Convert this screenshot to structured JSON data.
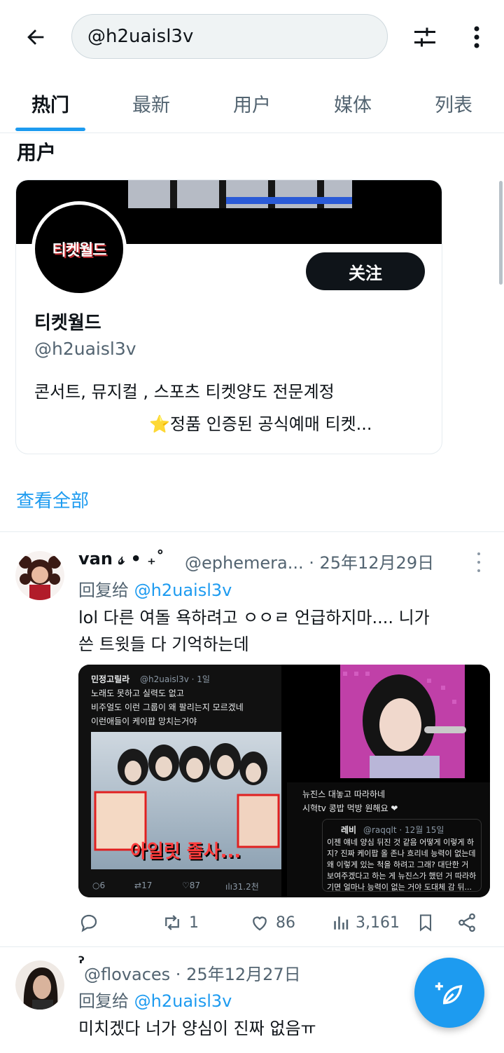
{
  "search": {
    "query": "@h2uaisl3v"
  },
  "tabs": [
    {
      "label": "热门"
    },
    {
      "label": "最新"
    },
    {
      "label": "用户"
    },
    {
      "label": "媒体"
    },
    {
      "label": "列表"
    }
  ],
  "users_section": {
    "title": "用户",
    "card": {
      "avatar_text": "티켓월드",
      "follow_label": "关注",
      "name": "티켓월드",
      "handle": "@h2uaisl3v",
      "bio_line1": "콘서트, 뮤지컬 , 스포츠 티켓양도 전문계정",
      "bio_star": "⭐",
      "bio_line2": "정품 인증된 공식예매 티켓..."
    },
    "see_all": "查看全部"
  },
  "tweet1": {
    "name": "van 𝓈 • ₊˚",
    "handle_date": "@ephemera... · 25年12月29日",
    "reply_prefix": "回复给",
    "reply_handle": "@h2uaisl3v",
    "text_line1": "lol 다른 여돌 욕하려고 ㅇㅇㄹ 언급하지마.... 니가",
    "text_line2": "쓴 트윗들 다 기억하는데",
    "media": {
      "m1_name": "민정고릴라",
      "m1_handle": "@h2uaisl3v · 1일",
      "m1_line1": "노래도 못하고 실력도 없고",
      "m1_line2": "비주얼도 이런 그룹이 왜 팔리는지 모르겠네",
      "m1_line3": "이런애들이 케이팝 망치는거야",
      "m1_caption": "아일릿 졸사...",
      "m1_stats": [
        "6",
        "17",
        "87",
        "31.2천"
      ],
      "m3_line1": "뉴진스 대놓고 따라하네",
      "m3_line2": "시혁tv 콩밥 먹방 원해요 ❤",
      "m3_quote_name": "레비",
      "m3_quote_meta": "@raqqlt · 12월 15일",
      "m3_q1": "이젠 얘네 양심 뒤진 것 같음 어떻게 이렇게 하",
      "m3_q2": "지? 진짜 케이팝 올 존나 흐리네 능력이 없는데",
      "m3_q3": "왜 이렇게 있는 척을 하려고 그래? 대단한 거",
      "m3_q4": "보여주겠다고 하는 게 뉴진스가 했던 거 따라하",
      "m3_q5": "기면 얼마나 능력이 없는 거야 도대체 감 뒤..."
    },
    "actions": {
      "reply": "",
      "retweet": "1",
      "like": "86",
      "views": "3,161"
    }
  },
  "tweet2": {
    "name": "ˀ",
    "handle_date": "@flovaces · 25年12月27日",
    "reply_prefix": "回复给",
    "reply_handle": "@h2uaisl3v",
    "text": "미치겠다 너가 양심이 진짜 없음ㅠ"
  },
  "colors": {
    "accent": "#1d9bf0",
    "text": "#0f1419",
    "muted": "#536471"
  }
}
